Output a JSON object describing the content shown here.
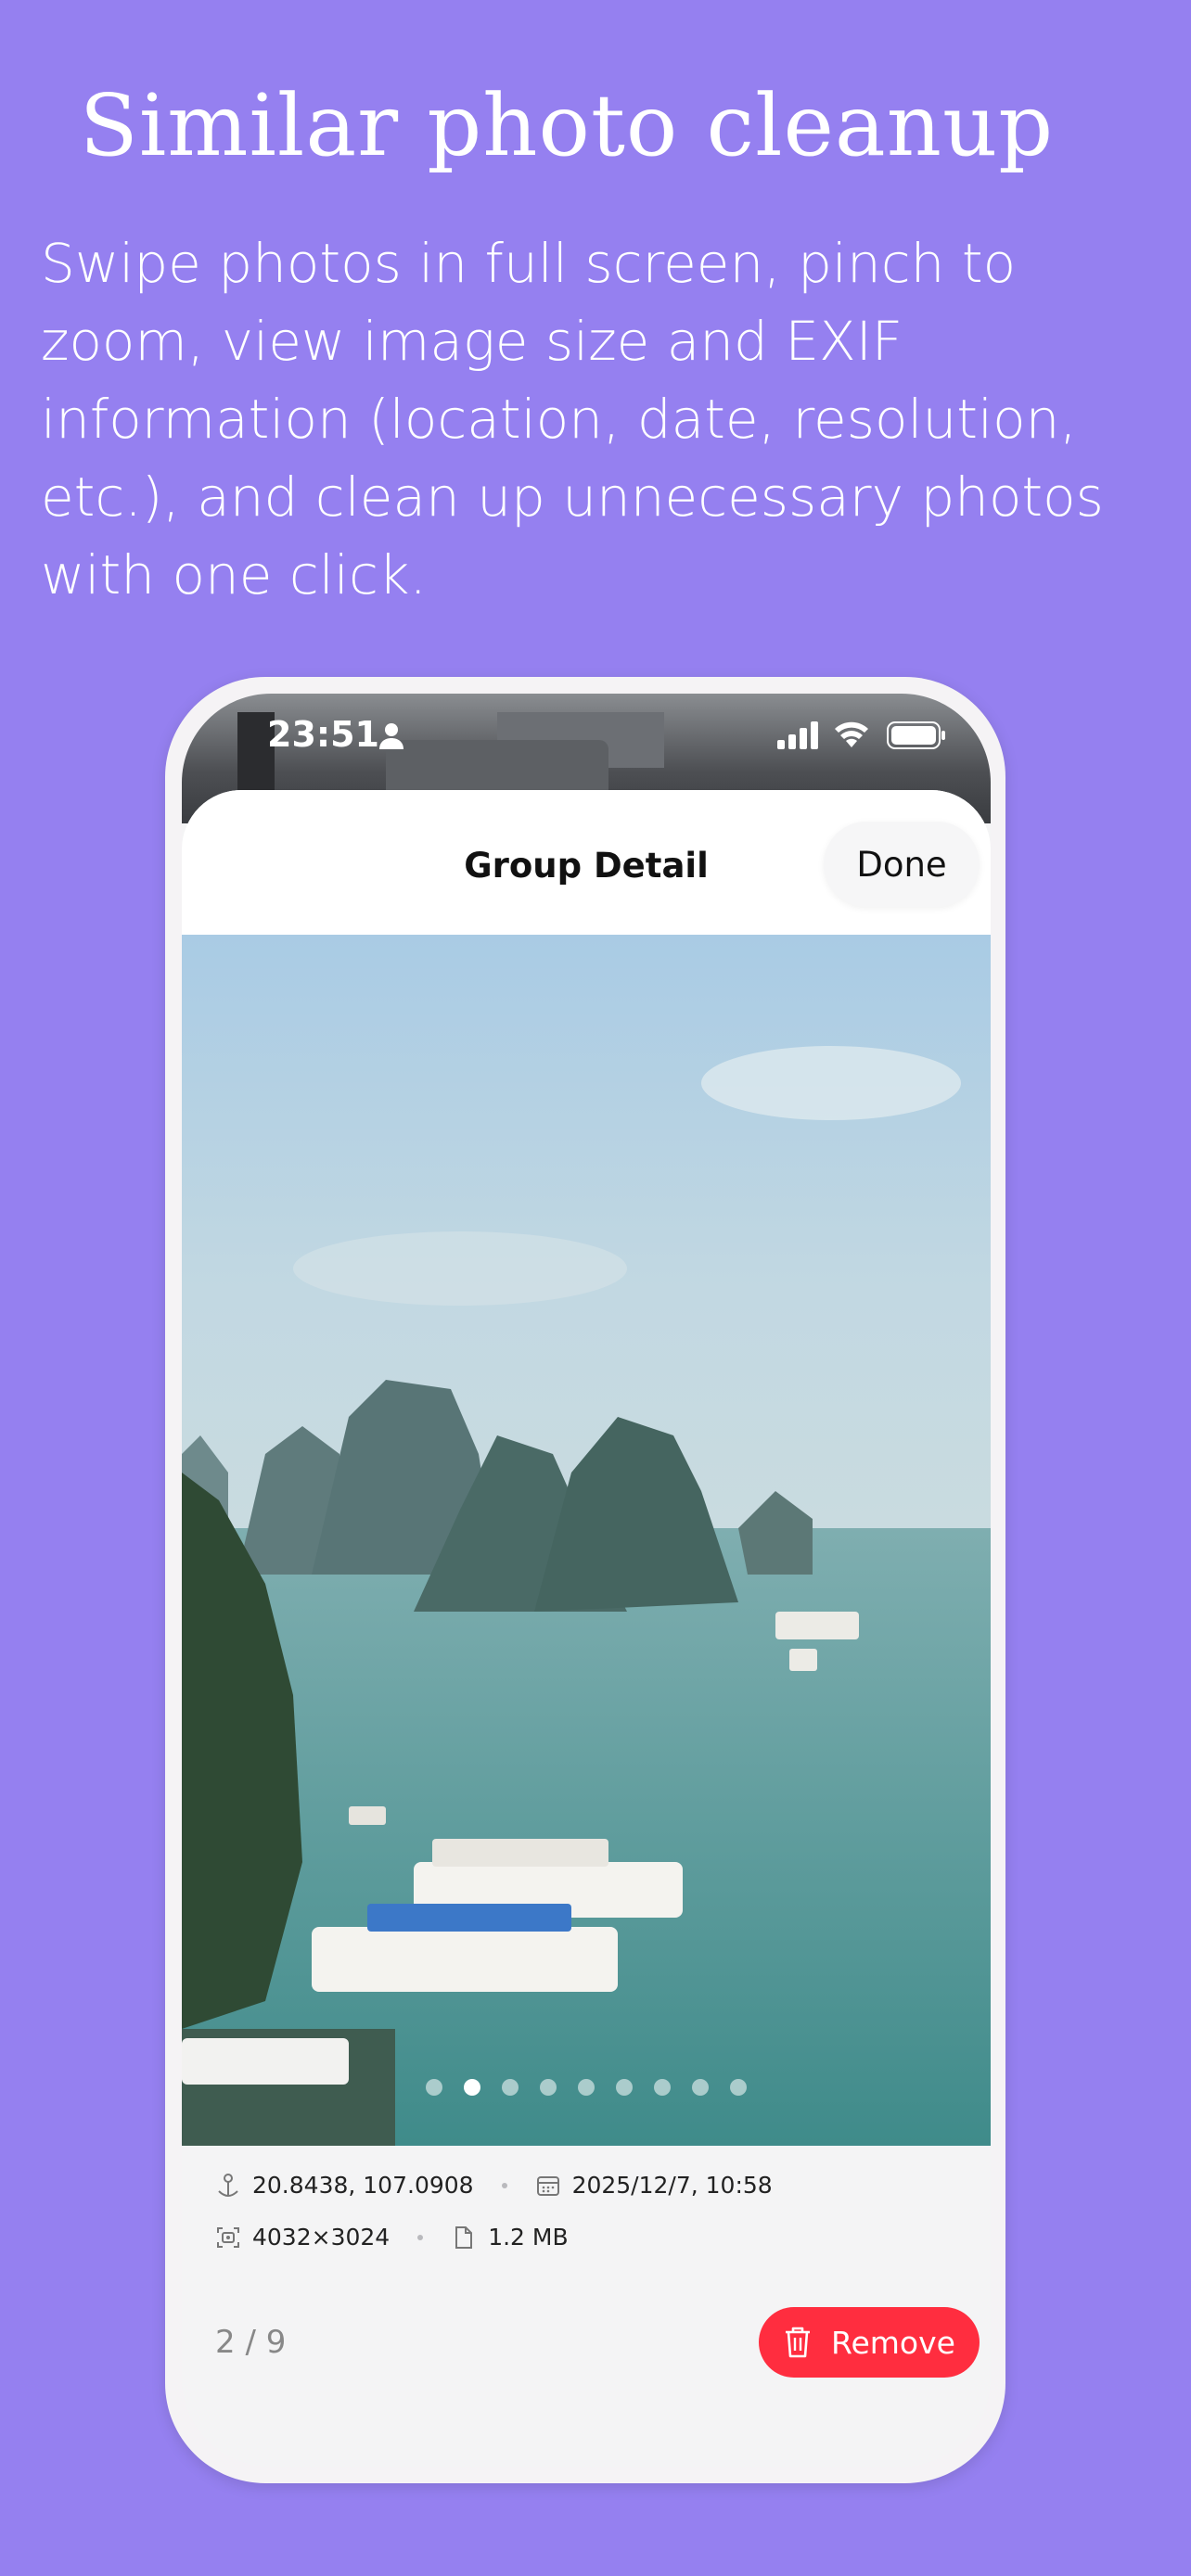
{
  "header": {
    "title": "Similar photo cleanup",
    "description": "Swipe photos in full screen, pinch to zoom, view image size and EXIF information (location, date, resolution, etc.), and clean up unnecessary photos with one click."
  },
  "status_bar": {
    "time": "23:51"
  },
  "nav": {
    "title": "Group Detail",
    "done_label": "Done"
  },
  "photo": {
    "pagination_count": 9,
    "active_index": 2
  },
  "metadata": {
    "location": "20.8438, 107.0908",
    "date": "2025/12/7, 10:58",
    "resolution": "4032×3024",
    "size": "1.2 MB"
  },
  "footer": {
    "counter": "2 / 9",
    "remove_label": "Remove"
  },
  "colors": {
    "background": "#9580f0",
    "remove": "#ff2d3f"
  }
}
